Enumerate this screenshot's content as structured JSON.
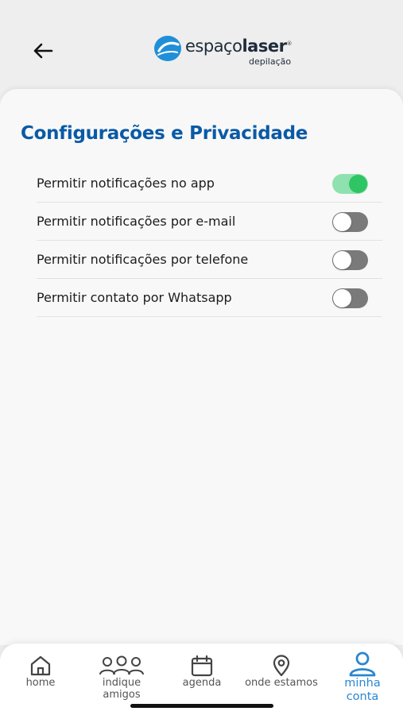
{
  "header": {
    "back_icon": "arrow-left-icon",
    "logo": {
      "word_light": "espaço",
      "word_bold": "laser",
      "registered": "®",
      "subtitle": "depilação",
      "mark_color": "#1f8fd8"
    }
  },
  "page": {
    "title": "Configurações e Privacidade",
    "title_color": "#0a5aa6"
  },
  "settings": [
    {
      "label": "Permitir notificações no app",
      "enabled": true
    },
    {
      "label": "Permitir notificações por e-mail",
      "enabled": false
    },
    {
      "label": "Permitir notificações por telefone",
      "enabled": false
    },
    {
      "label": "Permitir contato por Whatsapp",
      "enabled": false
    }
  ],
  "toggle_colors": {
    "on_track": "#8fe1b0",
    "on_knob": "#2fc464",
    "off_track": "#7a7a7a",
    "off_knob": "#ffffff"
  },
  "bottom_nav": {
    "active_color": "#2a86d1",
    "items": [
      {
        "label": "home",
        "icon": "home-icon",
        "active": false
      },
      {
        "label": "indique\namigos",
        "icon": "people-icon",
        "active": false
      },
      {
        "label": "agenda",
        "icon": "calendar-icon",
        "active": false
      },
      {
        "label": "onde estamos",
        "icon": "location-pin-icon",
        "active": false
      },
      {
        "label": "minha\nconta",
        "icon": "user-icon",
        "active": true
      }
    ]
  }
}
